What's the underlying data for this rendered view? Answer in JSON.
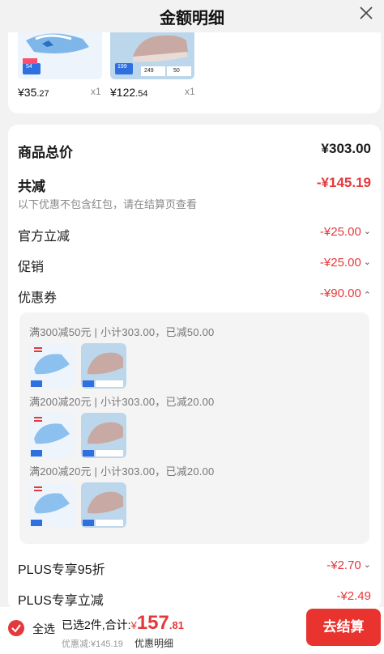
{
  "header": {
    "title": "金额明细"
  },
  "products": [
    {
      "price_int": "¥35",
      "price_dec": ".27",
      "qty": "x1",
      "badge": "54"
    },
    {
      "price_int": "¥122",
      "price_dec": ".54",
      "qty": "x1",
      "badge": "199",
      "thumb_num1": "249",
      "thumb_num2": "50"
    }
  ],
  "summary": {
    "total_label": "商品总价",
    "total_value": "¥303.00",
    "discount_label": "共减",
    "discount_value": "-¥145.19",
    "discount_note": "以下优惠不包含红包，请在结算页查看",
    "items": [
      {
        "label": "官方立减",
        "value": "-¥25.00"
      },
      {
        "label": "促销",
        "value": "-¥25.00"
      },
      {
        "label": "优惠券",
        "value": "-¥90.00"
      }
    ]
  },
  "coupons": [
    {
      "text": "满300减50元 | 小计303.00，已减50.00"
    },
    {
      "text": "满200减20元 | 小计303.00，已减20.00"
    },
    {
      "text": "满200减20元 | 小计303.00，已减20.00"
    }
  ],
  "plus": [
    {
      "label": "PLUS专享95折",
      "value": "-¥2.70"
    },
    {
      "label": "PLUS专享立减",
      "value": "-¥2.49"
    }
  ],
  "bottom": {
    "select_all": "全选",
    "selected": "已选2件,合计:",
    "currency": "¥",
    "total_int": "157",
    "total_dec": ".81",
    "discount_note": "优惠减:¥145.19",
    "detail_link": "优惠明细",
    "checkout": "去结算"
  },
  "colors": {
    "accent": "#e4393c",
    "button": "#e8332f",
    "background": "#f2f2f2"
  }
}
